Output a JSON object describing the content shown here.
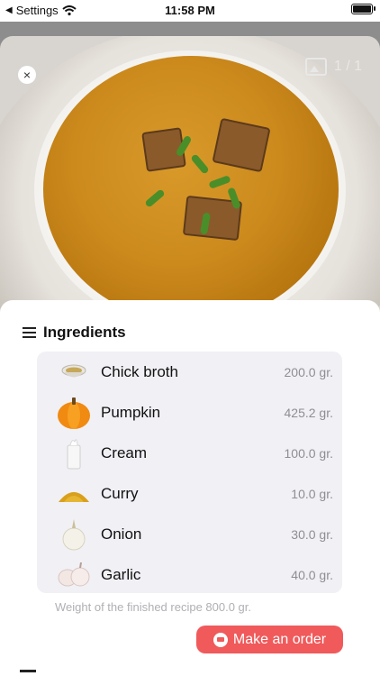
{
  "status_bar": {
    "back_label": "Settings",
    "time": "11:58 PM"
  },
  "gallery": {
    "counter": "1 / 1"
  },
  "sheet": {
    "title": "Ingredients",
    "ingredients": [
      {
        "name": "Chick broth",
        "qty": "200.0 gr.",
        "icon": "broth-bowl-icon"
      },
      {
        "name": "Pumpkin",
        "qty": "425.2 gr.",
        "icon": "pumpkin-icon"
      },
      {
        "name": "Cream",
        "qty": "100.0 gr.",
        "icon": "cream-glass-icon"
      },
      {
        "name": "Curry",
        "qty": "10.0 gr.",
        "icon": "curry-powder-icon"
      },
      {
        "name": "Onion",
        "qty": "30.0 gr.",
        "icon": "onion-icon"
      },
      {
        "name": "Garlic",
        "qty": "40.0 gr.",
        "icon": "garlic-icon"
      }
    ],
    "weight_note": "Weight of the finished recipe 800.0 gr.",
    "order_button": "Make an order"
  },
  "colors": {
    "accent": "#f05a5b",
    "card_bg": "#f1f0f5"
  }
}
